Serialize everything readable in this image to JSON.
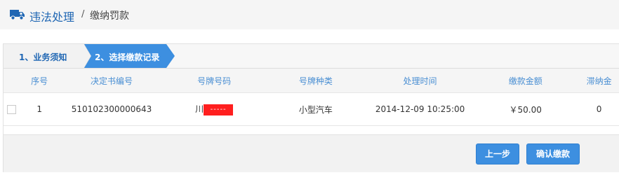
{
  "header": {
    "title": "违法处理",
    "separator": "/",
    "breadcrumb": "缴纳罚款"
  },
  "steps": [
    {
      "label": "1、业务须知",
      "active": false
    },
    {
      "label": "2、选择缴款记录",
      "active": true
    }
  ],
  "table": {
    "columns": [
      "序号",
      "决定书编号",
      "号牌号码",
      "号牌种类",
      "处理时间",
      "缴款金额",
      "滞纳金"
    ],
    "rows": [
      {
        "checked": false,
        "index": "1",
        "decision_no": "510102300000643",
        "plate_prefix": "川",
        "plate_masked": "-----",
        "plate_type": "小型汽车",
        "time": "2014-12-09 10:25:00",
        "amount": "￥50.00",
        "late_fee": "0"
      }
    ]
  },
  "buttons": {
    "prev": "上一步",
    "confirm": "确认缴款"
  },
  "colors": {
    "accent": "#3d8fe0",
    "title": "#1f66b3",
    "mask": "#ff1f1f"
  },
  "icons": {
    "header": "truck-icon"
  }
}
